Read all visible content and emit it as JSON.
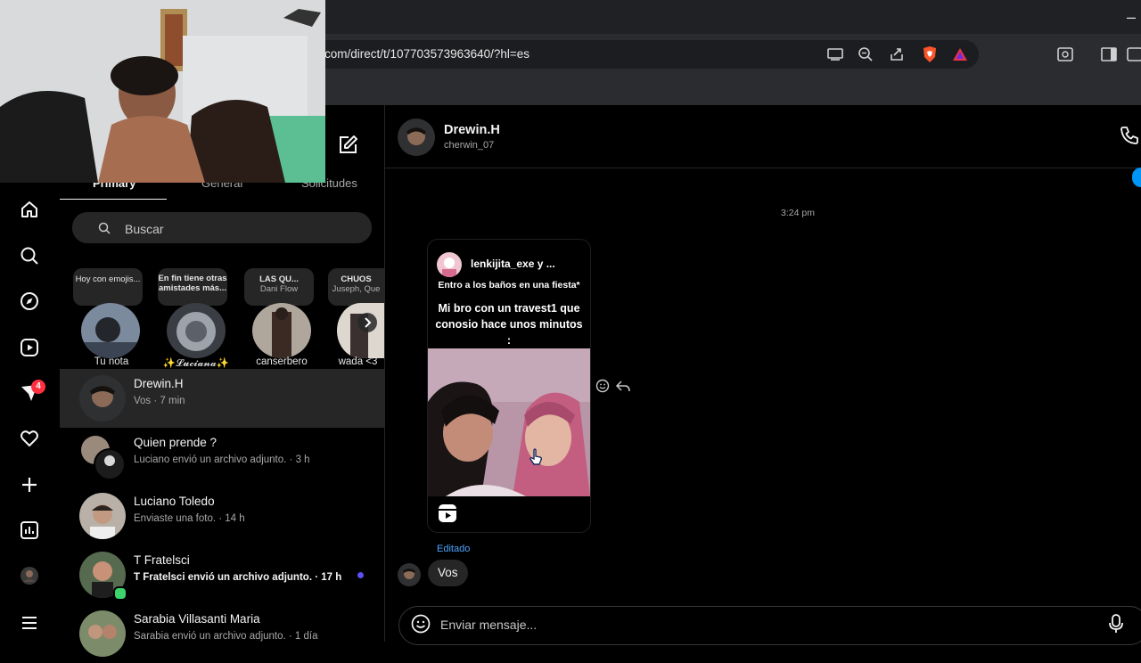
{
  "browser": {
    "url": "com/direct/t/107703573963640/?hl=es",
    "minimize": "–"
  },
  "tabs": {
    "primary": "Primary",
    "general": "General",
    "requests": "Solicitudes"
  },
  "search": {
    "placeholder": "Buscar"
  },
  "nav": {
    "notifications_badge": "4"
  },
  "notes": [
    {
      "text": "Hoy con emojis...",
      "name": "Tu nota"
    },
    {
      "text": "En fin tiene otras amistades más...",
      "name": "✨𝓛𝓾𝓬𝓲𝓪𝓷𝓪✨"
    },
    {
      "text": "LAS QU...",
      "sub": "Dani Flow",
      "name": "canserbero"
    },
    {
      "text": "CHUOS",
      "sub": "Juseph, Que",
      "name": "wada <3"
    }
  ],
  "conversations": [
    {
      "name": "Drewin.H",
      "sub": "Vos · 7 min"
    },
    {
      "name": "Quien prende ?",
      "sub": "Luciano envió un archivo adjunto. · 3 h"
    },
    {
      "name": "Luciano Toledo",
      "sub": "Enviaste una foto. · 14 h"
    },
    {
      "name": "T Fratelsci",
      "sub": "T Fratelsci envió un archivo adjunto. · 17 h"
    },
    {
      "name": "Sarabia Villasanti Maria",
      "sub": "Sarabia envió un archivo adjunto. · 1 día"
    }
  ],
  "chat": {
    "name": "Drewin.H",
    "username": "cherwin_07",
    "timestamp": "3:24 pm",
    "reel": {
      "author": "lenkijita_exe y ...",
      "line1": "Entro a los baños en una fiesta*",
      "line2": "Mi bro con un travest1 que conosio hace unos minutos :"
    },
    "edited": "Editado",
    "message": "Vos",
    "composer_placeholder": "Enviar mensaje..."
  },
  "colors": {
    "accent": "#0095f6",
    "badge": "#ff3040",
    "edited": "#4da3ff"
  }
}
